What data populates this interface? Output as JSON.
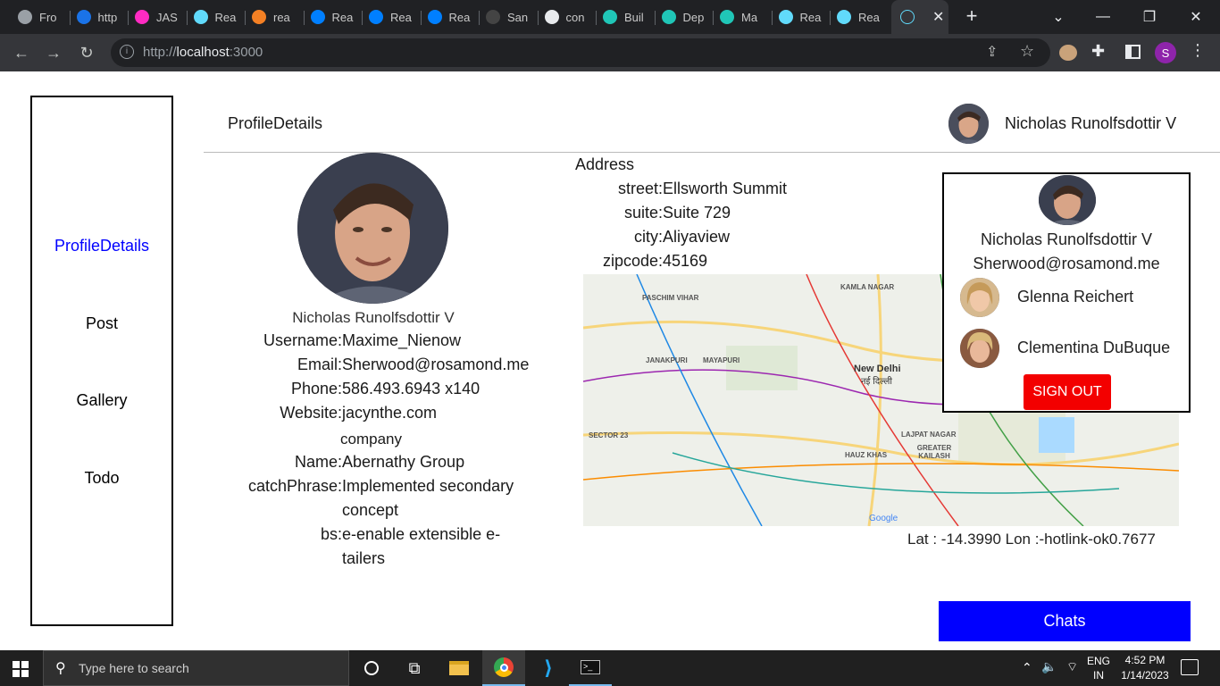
{
  "browser": {
    "tabs": [
      {
        "label": "Fro",
        "icon": "globe-icon",
        "color": "#9aa0a6"
      },
      {
        "label": "http",
        "icon": "loading-icon",
        "color": "#1a73e8"
      },
      {
        "label": "JAS",
        "icon": "xd-icon",
        "color": "#ff2bc2"
      },
      {
        "label": "Rea",
        "icon": "react-icon",
        "color": "#61dafb"
      },
      {
        "label": "rea",
        "icon": "stackoverflow-icon",
        "color": "#f48024"
      },
      {
        "label": "Rea",
        "icon": "mui-icon",
        "color": "#007fff"
      },
      {
        "label": "Rea",
        "icon": "mui-icon",
        "color": "#007fff"
      },
      {
        "label": "Rea",
        "icon": "mui-icon",
        "color": "#007fff"
      },
      {
        "label": "San",
        "icon": "codesandbox-icon",
        "color": "#444"
      },
      {
        "label": "con",
        "icon": "github-icon",
        "color": "#e8eaed"
      },
      {
        "label": "Buil",
        "icon": "netlify-icon",
        "color": "#20c6b7"
      },
      {
        "label": "Dep",
        "icon": "netlify-error-icon",
        "color": "#20c6b7"
      },
      {
        "label": "Ma",
        "icon": "netlify-icon",
        "color": "#20c6b7"
      },
      {
        "label": "Rea",
        "icon": "react-icon",
        "color": "#61dafb"
      },
      {
        "label": "Rea",
        "icon": "react-icon",
        "color": "#61dafb"
      }
    ],
    "url_prefix": "http://",
    "url_host": "localhost",
    "url_suffix": ":3000",
    "profile_initial": "S"
  },
  "sidebar": {
    "items": [
      {
        "label": "ProfileDetails",
        "active": true
      },
      {
        "label": "Post"
      },
      {
        "label": "Gallery"
      },
      {
        "label": "Todo"
      }
    ]
  },
  "header": {
    "title": "ProfileDetails",
    "user_name": "Nicholas Runolfsdottir V"
  },
  "profile": {
    "name": "Nicholas Runolfsdottir V",
    "username_label": "Username:",
    "username": "Maxime_Nienow",
    "email_label": "Email:",
    "email": "Sherwood@rosamond.me",
    "phone_label": "Phone:",
    "phone": "586.493.6943 x140",
    "website_label": "Website:",
    "website": "jacynthe.com",
    "company_heading": "company",
    "company_name_label": "Name:",
    "company_name": "Abernathy Group",
    "catchphrase_label": "catchPhrase:",
    "catchphrase_line1": "Implemented secondary",
    "catchphrase_line2": "concept",
    "bs_label": "bs:",
    "bs_line1": "e-enable extensible e-",
    "bs_line2": "tailers"
  },
  "address": {
    "title": "Address",
    "street_label": "street:",
    "street": "Ellsworth Summit",
    "suite_label": "suite:",
    "suite": "Suite 729",
    "city_label": "city:",
    "city": "Aliyaview",
    "zipcode_label": "zipcode:",
    "zipcode": "45169",
    "coords": "Lat : -14.3990  Lon :-hotlink-ok0.7677"
  },
  "map": {
    "labels": [
      "PASCHIM VIHAR",
      "KAMLA NAGAR",
      "JANAKPURI",
      "MAYAPURI",
      "New Delhi",
      "नई दिल्ली",
      "SECTOR 23",
      "LAJPAT NAGAR",
      "HAUZ KHAS",
      "GREATER KAILASH",
      "Google"
    ]
  },
  "popup": {
    "name": "Nicholas Runolfsdottir V",
    "email": "Sherwood@rosamond.me",
    "users": [
      {
        "name": "Glenna Reichert"
      },
      {
        "name": "Clementina DuBuque"
      }
    ],
    "signout_label": "SIGN OUT"
  },
  "chats_label": "Chats",
  "taskbar": {
    "search_placeholder": "Type here to search",
    "lang_line1": "ENG",
    "lang_line2": "IN",
    "time": "4:52 PM",
    "date": "1/14/2023"
  },
  "colors": {
    "accent_link": "#0000ff",
    "signout_red": "#f30000",
    "chats_blue": "#0000ff"
  }
}
